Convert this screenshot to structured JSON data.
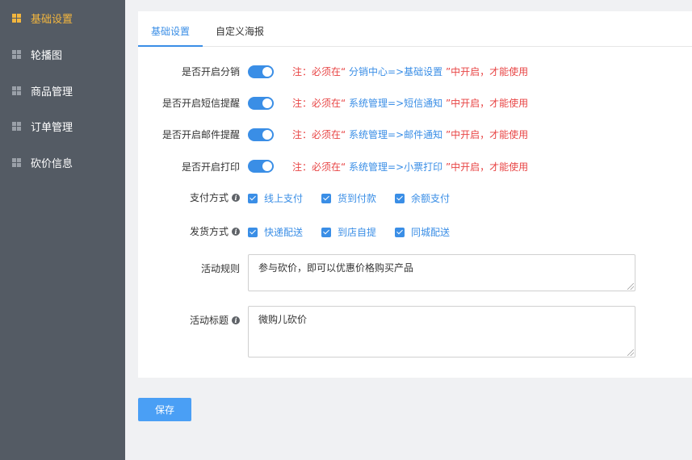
{
  "sidebar": {
    "items": [
      {
        "label": "基础设置",
        "icon": "grid-icon",
        "active": true
      },
      {
        "label": "轮播图",
        "icon": "grid-icon",
        "active": false
      },
      {
        "label": "商品管理",
        "icon": "grid-icon",
        "active": false
      },
      {
        "label": "订单管理",
        "icon": "grid-icon",
        "active": false
      },
      {
        "label": "砍价信息",
        "icon": "grid-icon",
        "active": false
      }
    ]
  },
  "tabs": [
    {
      "label": "基础设置",
      "active": true
    },
    {
      "label": "自定义海报",
      "active": false
    }
  ],
  "switches": [
    {
      "label": "是否开启分销",
      "on": true,
      "note_prefix": "注：必须在“",
      "note_path": " 分销中心=>基础设置 ",
      "note_suffix": "”中开启，才能使用"
    },
    {
      "label": "是否开启短信提醒",
      "on": true,
      "note_prefix": "注：必须在“",
      "note_path": " 系统管理=>短信通知 ",
      "note_suffix": "”中开启，才能使用"
    },
    {
      "label": "是否开启邮件提醒",
      "on": true,
      "note_prefix": "注：必须在“",
      "note_path": " 系统管理=>邮件通知 ",
      "note_suffix": "”中开启，才能使用"
    },
    {
      "label": "是否开启打印",
      "on": true,
      "note_prefix": "注：必须在“",
      "note_path": " 系统管理=>小票打印 ",
      "note_suffix": "”中开启，才能使用"
    }
  ],
  "payment": {
    "label": "支付方式",
    "options": [
      {
        "label": "线上支付",
        "checked": true
      },
      {
        "label": "货到付款",
        "checked": true
      },
      {
        "label": "余额支付",
        "checked": true
      }
    ]
  },
  "delivery": {
    "label": "发货方式",
    "options": [
      {
        "label": "快递配送",
        "checked": true
      },
      {
        "label": "到店自提",
        "checked": true
      },
      {
        "label": "同城配送",
        "checked": true
      }
    ]
  },
  "rules": {
    "label": "活动规则",
    "value": "参与砍价，即可以优惠价格购买产品"
  },
  "title_field": {
    "label": "活动标题",
    "value": "微购儿砍价"
  },
  "save_label": "保存",
  "colors": {
    "accent": "#3a8ee6",
    "sidebar_bg": "#545b64",
    "active_menu": "#f3b63e",
    "note_red": "#e84545"
  }
}
